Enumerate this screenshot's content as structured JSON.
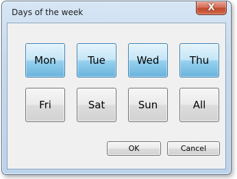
{
  "window": {
    "title": "Days of the week",
    "close_glyph": "X"
  },
  "days": [
    {
      "label": "Mon",
      "selected": true
    },
    {
      "label": "Tue",
      "selected": true
    },
    {
      "label": "Wed",
      "selected": true
    },
    {
      "label": "Thu",
      "selected": true
    },
    {
      "label": "Fri",
      "selected": false
    },
    {
      "label": "Sat",
      "selected": false
    },
    {
      "label": "Sun",
      "selected": false
    },
    {
      "label": "All",
      "selected": false
    }
  ],
  "buttons": {
    "ok_label": "OK",
    "cancel_label": "Cancel"
  },
  "colors": {
    "selected_accent": "#68b3db",
    "close_button": "#c04a2d"
  }
}
